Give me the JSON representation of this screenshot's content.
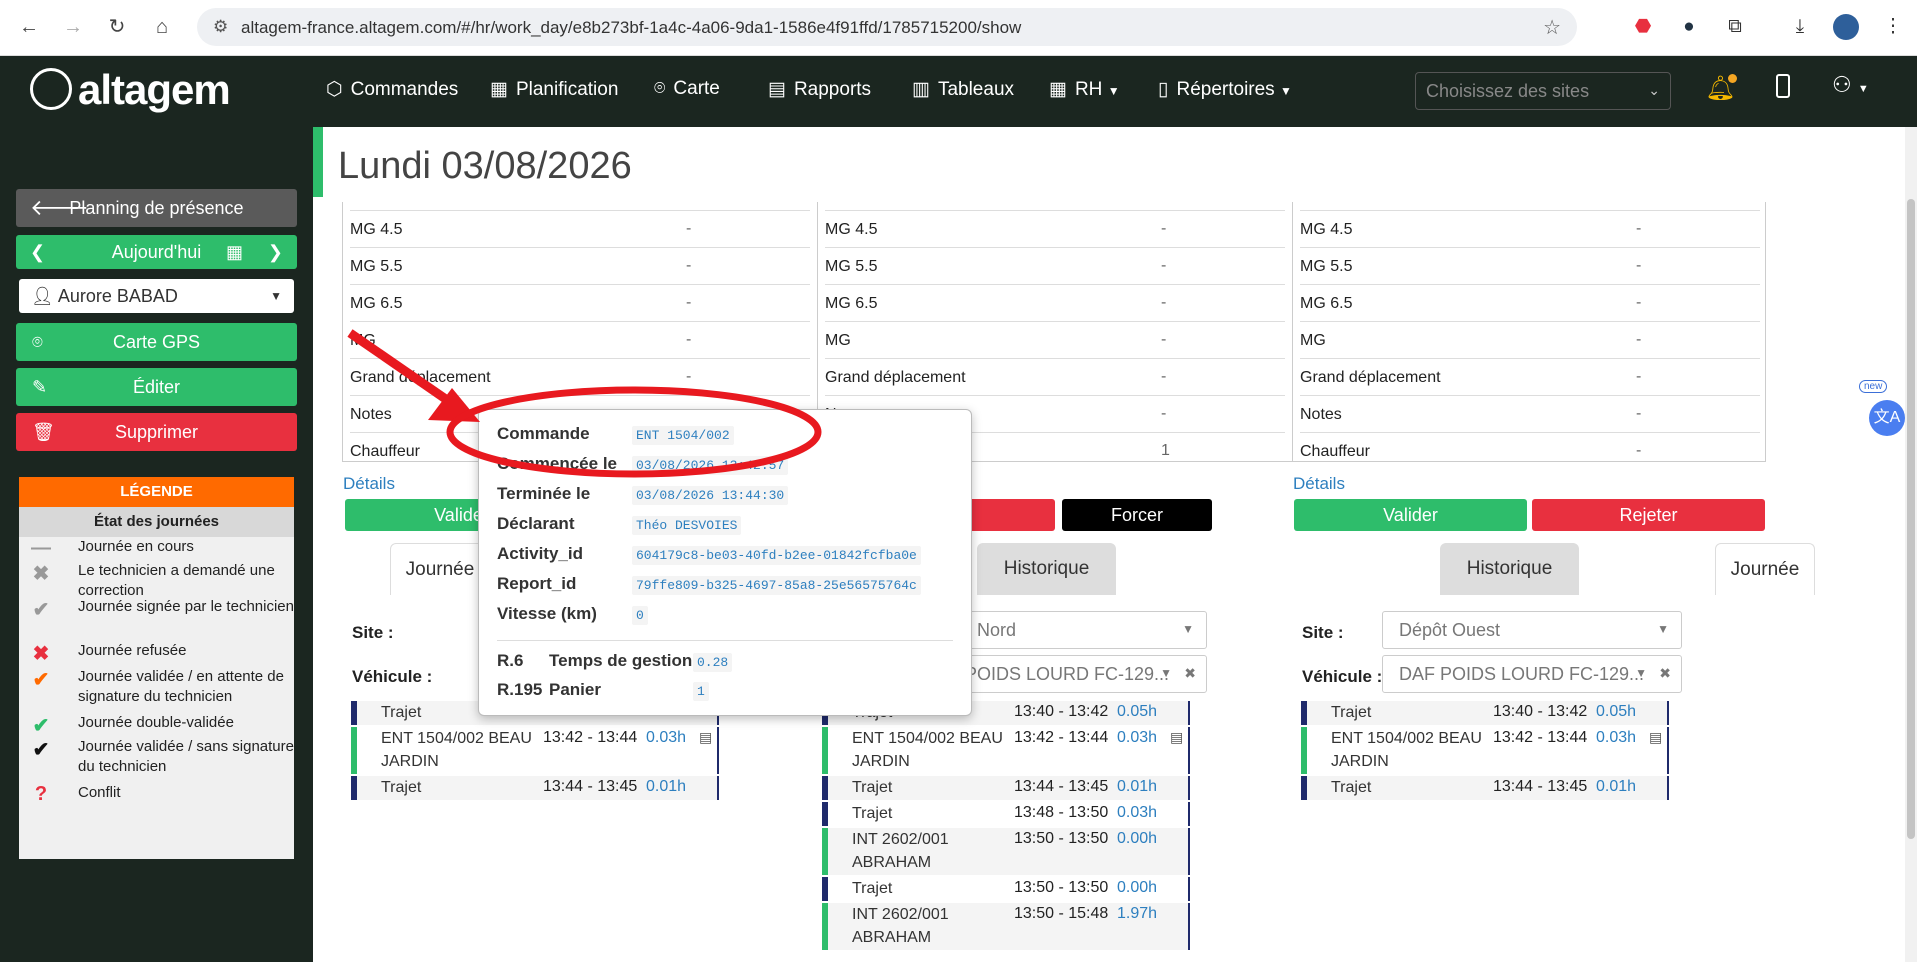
{
  "browser": {
    "url": "altagem-france.altagem.com/#/hr/work_day/e8b273bf-1a4c-4a06-9da1-1586e4f91ffd/1785715200/show"
  },
  "app": {
    "logo": "altagem",
    "site_placeholder": "Choisissez des sites",
    "menu": [
      "Commandes",
      "Planification",
      "Carte",
      "Rapports",
      "Tableaux",
      "RH",
      "Répertoires"
    ]
  },
  "sidebar": {
    "back": "Planning de présence",
    "today": "Aujourd'hui",
    "user": "Aurore BABAD",
    "gps": "Carte GPS",
    "edit": "Éditer",
    "delete": "Supprimer",
    "legend_title": "LÉGENDE",
    "legend_sub": "État des journées",
    "legend": [
      {
        "icon": "—",
        "text": "Journée en cours",
        "color": "#999"
      },
      {
        "icon": "✖",
        "text": "Le technicien a demandé une correction",
        "color": "#999"
      },
      {
        "icon": "✔",
        "text": "Journée signée par le technicien",
        "color": "#999"
      },
      {
        "icon": "✖",
        "text": "Journée refusée",
        "color": "#e8303f"
      },
      {
        "icon": "✔",
        "text": "Journée validée / en attente de signature du technicien",
        "color": "#ff6a00"
      },
      {
        "icon": "✔",
        "text": "Journée double-validée",
        "color": "#2ebd6b"
      },
      {
        "icon": "✔",
        "text": "Journée validée / sans signature du technicien",
        "color": "#111"
      },
      {
        "icon": "?",
        "text": "Conflit",
        "color": "#e8303f"
      }
    ]
  },
  "page": {
    "title": "Lundi 03/08/2026",
    "rows": [
      "MG 4.5",
      "MG 5.5",
      "MG 6.5",
      "MG",
      "Grand déplacement",
      "Notes",
      "Chauffeur"
    ],
    "col1_values": [
      "-",
      "-",
      "-",
      "-",
      "-",
      "-",
      ""
    ],
    "col2_values": [
      "-",
      "-",
      "-",
      "-",
      "-",
      "-",
      "1"
    ],
    "col3_values": [
      "-",
      "-",
      "-",
      "-",
      "-",
      "-",
      "-"
    ],
    "col2_notes_partial": "No",
    "details": "Détails",
    "validate": "Valider",
    "reject": "Rejeter",
    "force": "Forcer",
    "tab_day": "Journée",
    "tab_history": "Historique",
    "site_label": "Site :",
    "vehicle_label": "Véhicule :",
    "site2": "Dépôt Nord",
    "site3": "Dépôt Ouest",
    "vehicle": "DAF POIDS LOURD FC-129...",
    "col1_timeline": [
      {
        "name": "Trajet",
        "time": "13:40 - 13:42",
        "h": "0.05h",
        "color": "#1f2a6b"
      },
      {
        "name": "ENT 1504/002 BEAU JARDIN",
        "time": "13:42 - 13:44",
        "h": "0.03h",
        "color": "#2ebd6b"
      },
      {
        "name": "Trajet",
        "time": "13:44 - 13:45",
        "h": "0.01h",
        "color": "#1f2a6b"
      }
    ],
    "col2_timeline": [
      {
        "name": "Trajet",
        "time": "13:40 - 13:42",
        "h": "0.05h",
        "color": "#1f2a6b"
      },
      {
        "name": "ENT 1504/002 BEAU JARDIN",
        "time": "13:42 - 13:44",
        "h": "0.03h",
        "color": "#2ebd6b"
      },
      {
        "name": "Trajet",
        "time": "13:44 - 13:45",
        "h": "0.01h",
        "color": "#1f2a6b"
      },
      {
        "name": "Trajet",
        "time": "13:48 - 13:50",
        "h": "0.03h",
        "color": "#1f2a6b"
      },
      {
        "name": "INT 2602/001 ABRAHAM",
        "time": "13:50 - 13:50",
        "h": "0.00h",
        "color": "#2ebd6b"
      },
      {
        "name": "Trajet",
        "time": "13:50 - 13:50",
        "h": "0.00h",
        "color": "#1f2a6b"
      },
      {
        "name": "INT 2602/001 ABRAHAM",
        "time": "13:50 - 15:48",
        "h": "1.97h",
        "color": "#2ebd6b"
      }
    ],
    "col3_timeline": [
      {
        "name": "Trajet",
        "time": "13:40 - 13:42",
        "h": "0.05h",
        "color": "#1f2a6b"
      },
      {
        "name": "ENT 1504/002 BEAU JARDIN",
        "time": "13:42 - 13:44",
        "h": "0.03h",
        "color": "#2ebd6b"
      },
      {
        "name": "Trajet",
        "time": "13:44 - 13:45",
        "h": "0.01h",
        "color": "#1f2a6b"
      }
    ]
  },
  "popup": {
    "rows": [
      {
        "k": "Commande",
        "v": "ENT  1504/002"
      },
      {
        "k": "Commencée le",
        "v": "03/08/2026 13:42:57"
      },
      {
        "k": "Terminée le",
        "v": "03/08/2026 13:44:30"
      },
      {
        "k": "Déclarant",
        "v": "Théo DESVOIES"
      },
      {
        "k": "Activity_id",
        "v": "604179c8-be03-40fd-b2ee-01842fcfba0e"
      },
      {
        "k": "Report_id",
        "v": "79ffe809-b325-4697-85a8-25e56575764c"
      },
      {
        "k": "Vitesse (km)",
        "v": "0"
      }
    ],
    "r6_code": "R.6",
    "r6_label": "Temps de gestion",
    "r6_value": "0.28",
    "r195_code": "R.195",
    "r195_label": "Panier",
    "r195_value": "1"
  },
  "ext": {
    "badge_new": "new"
  }
}
